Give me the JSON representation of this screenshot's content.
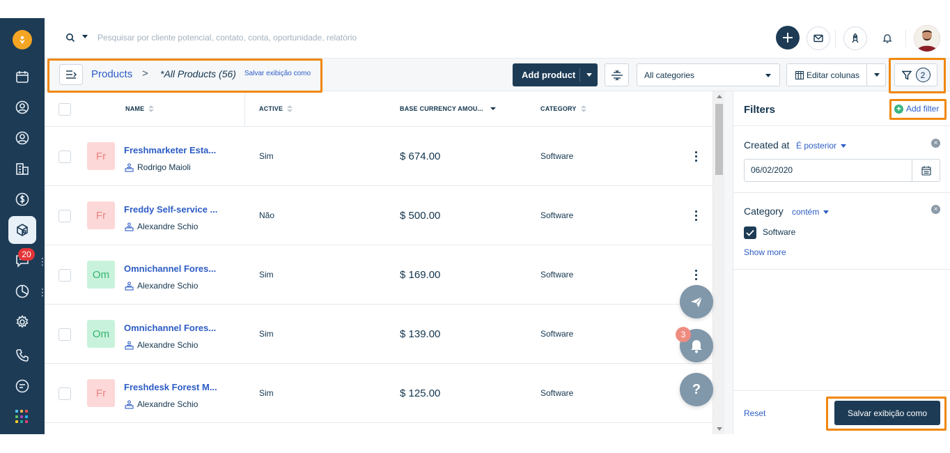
{
  "nav": {
    "chat_badge": "20",
    "items": [
      "logo-icon",
      "calendar-icon",
      "contacts-icon",
      "accounts-icon",
      "companies-icon",
      "deals-icon",
      "products-icon",
      "chat-icon",
      "reports-icon",
      "settings-icon",
      "phone-icon",
      "notes-icon",
      "apps-icon"
    ]
  },
  "search": {
    "placeholder": "Pesquisar por cliente potencial, contato, conta, oportunidade, relatório"
  },
  "breadcrumb": {
    "link": "Products",
    "separator": ">",
    "view_name": "*All Products",
    "count": "(56)",
    "save_view_link": "Salvar exibição como"
  },
  "toolbar": {
    "add_product": "Add product",
    "category_select": "All categories",
    "edit_columns": "Editar colunas",
    "filter_count": "2"
  },
  "table": {
    "headers": {
      "name": "NAME",
      "active": "ACTIVE",
      "amount": "BASE CURRENCY AMOU...",
      "category": "CATEGORY"
    },
    "rows": [
      {
        "initials": "Fr",
        "name": "Freshmarketer Esta...",
        "owner": "Rodrigo Maioli",
        "active": "Sim",
        "amount": "$ 674.00",
        "category": "Software",
        "thumb_bg": "#fdd8d8",
        "thumb_fg": "#e8837f"
      },
      {
        "initials": "Fr",
        "name": "Freddy Self-service ...",
        "owner": "Alexandre Schio",
        "active": "Não",
        "amount": "$ 500.00",
        "category": "Software",
        "thumb_bg": "#fdd8d8",
        "thumb_fg": "#e8837f"
      },
      {
        "initials": "Om",
        "name": "Omnichannel Fores...",
        "owner": "Alexandre Schio",
        "active": "Sim",
        "amount": "$ 169.00",
        "category": "Software",
        "thumb_bg": "#c9f2dc",
        "thumb_fg": "#34b46e"
      },
      {
        "initials": "Om",
        "name": "Omnichannel Fores...",
        "owner": "Alexandre Schio",
        "active": "Sim",
        "amount": "$ 139.00",
        "category": "Software",
        "thumb_bg": "#c9f2dc",
        "thumb_fg": "#34b46e"
      },
      {
        "initials": "Fr",
        "name": "Freshdesk Forest M...",
        "owner": "Alexandre Schio",
        "active": "Sim",
        "amount": "$ 125.00",
        "category": "Software",
        "thumb_bg": "#fdd8d8",
        "thumb_fg": "#e8837f"
      }
    ]
  },
  "floating": {
    "notification_badge": "3",
    "help_label": "?"
  },
  "filters": {
    "title": "Filters",
    "add_filter": "Add filter",
    "created_at": {
      "label": "Created at",
      "operator": "É posterior",
      "value": "06/02/2020"
    },
    "category": {
      "label": "Category",
      "operator": "contém",
      "option": "Software",
      "show_more": "Show more"
    },
    "reset": "Reset",
    "save_view": "Salvar exibição como"
  },
  "colors": {
    "nav_bg": "#1d3b55",
    "link": "#2c5cc5",
    "primary_btn": "#1d3b55",
    "highlight": "#f0880f"
  }
}
